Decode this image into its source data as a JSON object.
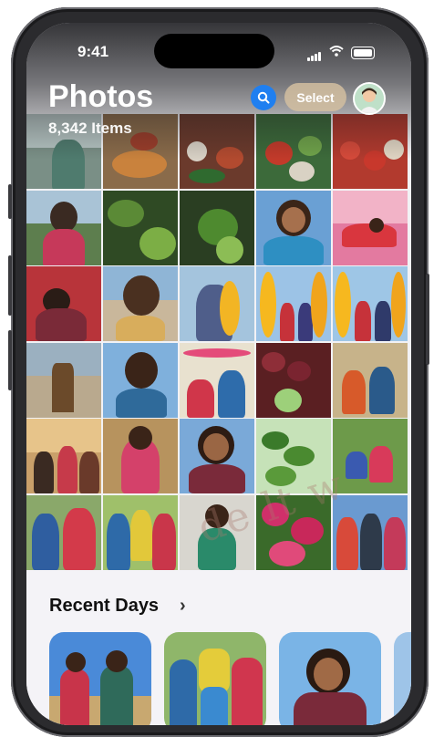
{
  "status": {
    "time": "9:41"
  },
  "header": {
    "title": "Photos",
    "item_count": "8,342 Items",
    "select_label": "Select",
    "search_icon": "search-icon"
  },
  "recent_days": {
    "title": "Recent Days"
  },
  "watermark": {
    "text": "de  lt w"
  },
  "colors": {
    "accent": "#1f7ff0",
    "select_bg": "#d2bea0"
  }
}
